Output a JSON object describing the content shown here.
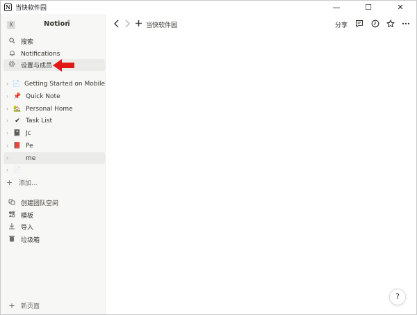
{
  "window": {
    "title": "当快软件园",
    "app_icon": "N",
    "minimize": "—",
    "maximize": "☐",
    "close": "✕"
  },
  "sidebar": {
    "workspace_badge": "X",
    "workspace_name": "Notion",
    "workspace_chevron": "⇕",
    "nav": [
      {
        "label": "搜索",
        "icon": "search-icon"
      },
      {
        "label": "Notifications",
        "icon": "bell-icon"
      },
      {
        "label": "设置与成员",
        "icon": "gear-icon"
      }
    ],
    "pages": [
      {
        "label": "Getting Started on Mobile",
        "icon": "📄"
      },
      {
        "label": "Quick Note",
        "icon": "📌"
      },
      {
        "label": "Personal Home",
        "icon": "🏡"
      },
      {
        "label": "Task List",
        "icon": "✔"
      },
      {
        "label": "Jc",
        "icon": "📓"
      },
      {
        "label": "Pe",
        "icon": "📕"
      },
      {
        "label": "me",
        "icon": ""
      },
      {
        "label": "",
        "icon": "📄"
      }
    ],
    "add_page": "添加...",
    "tools": [
      {
        "label": "创建团队空间",
        "icon": "team-space-icon"
      },
      {
        "label": "模板",
        "icon": "template-icon"
      },
      {
        "label": "导入",
        "icon": "import-icon"
      },
      {
        "label": "垃圾箱",
        "icon": "trash-icon"
      }
    ],
    "new_page": "新页面"
  },
  "topbar": {
    "breadcrumb": "当快软件园",
    "share": "分享"
  },
  "help": "?",
  "colors": {
    "sidebar_bg": "#f7f7f5",
    "active_bg": "#ebebea",
    "arrow": "#e01818",
    "text": "#37352f"
  }
}
